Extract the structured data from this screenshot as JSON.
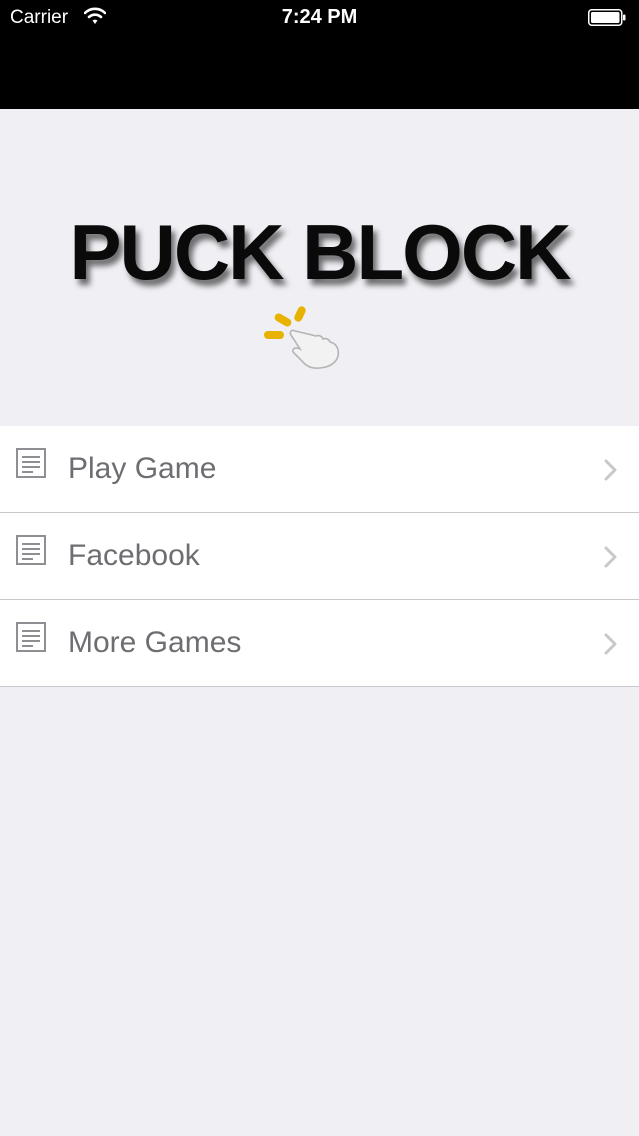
{
  "status_bar": {
    "carrier": "Carrier",
    "time": "7:24 PM",
    "background": "#000000"
  },
  "logo": {
    "title": "PUCK BLOCK",
    "tap_icon_accent": "#e8b200"
  },
  "menu": {
    "items": [
      {
        "label": "Play Game",
        "icon": "document-icon"
      },
      {
        "label": "Facebook",
        "icon": "document-icon"
      },
      {
        "label": "More Games",
        "icon": "document-icon"
      }
    ]
  },
  "colors": {
    "page_background": "#efeff4",
    "row_background": "#ffffff",
    "label_text": "#6d6d72",
    "separator": "#c8c7cc"
  }
}
